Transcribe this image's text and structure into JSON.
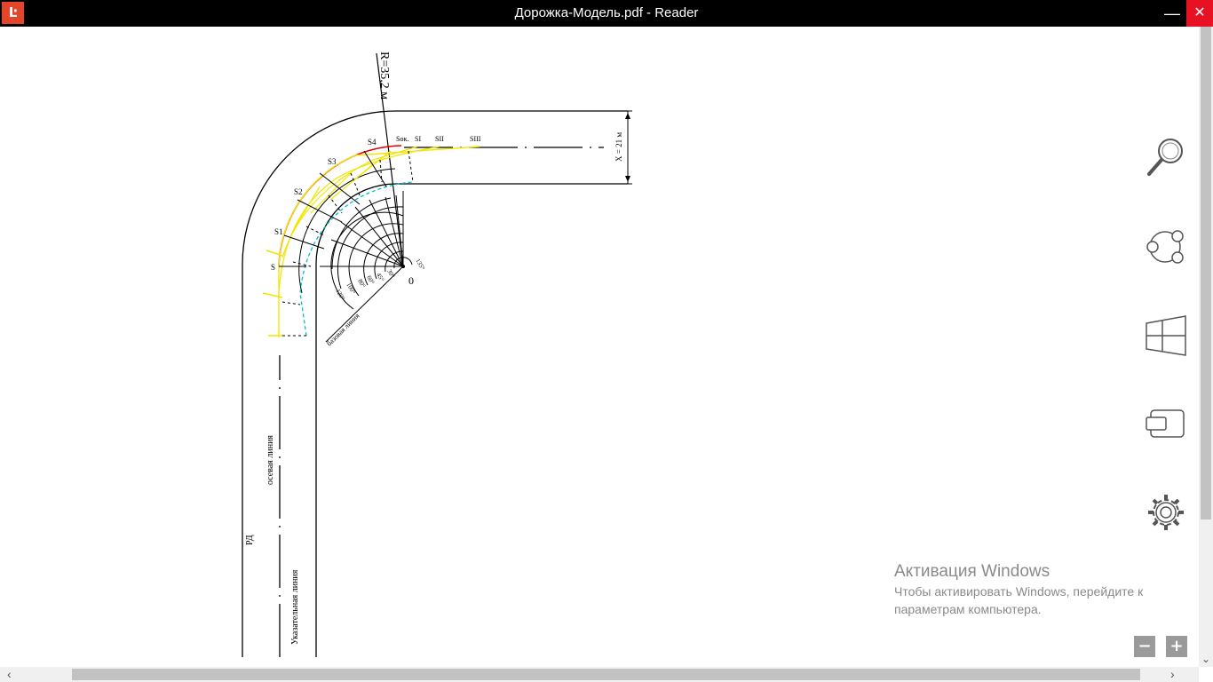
{
  "window": {
    "title": "Дорожка-Модель.pdf - Reader",
    "app_icon_glyph": "Ŀ",
    "minimize_glyph": "—",
    "close_glyph": "✕"
  },
  "drawing": {
    "radius_label": "R=35,2 м",
    "width_label": "X = 21 м",
    "label_s": "S",
    "label_s1": "S1",
    "label_s2": "S2",
    "label_s3": "S3",
    "label_s4": "S4",
    "label_sok": "Sок.",
    "label_s_i": "SI",
    "label_s_ii": "SII",
    "label_s_iii": "SIII",
    "label_center": "0",
    "angle_135": "135°",
    "angle_120": "120°",
    "angle_100": "100°",
    "angle_80": "80°",
    "angle_60": "60°",
    "angle_45": "45°",
    "angle_30": "30°",
    "base_line": "базовая линия",
    "axis_line": "осевая линия",
    "rd_label": "РД",
    "guide_line": "Указательная линия"
  },
  "charms": [
    {
      "name": "search",
      "icon": "search-icon"
    },
    {
      "name": "share",
      "icon": "share-icon"
    },
    {
      "name": "start",
      "icon": "windows-icon"
    },
    {
      "name": "devices",
      "icon": "devices-icon"
    },
    {
      "name": "settings",
      "icon": "gear-icon"
    }
  ],
  "zoom": {
    "minus": "−",
    "plus": "+"
  },
  "watermark": {
    "title": "Активация Windows",
    "line1": "Чтобы активировать Windows, перейдите к",
    "line2": "параметрам компьютера."
  },
  "scroll": {
    "left": "‹",
    "right": "›",
    "down": "⌄"
  },
  "colors": {
    "accent": "#e2452a",
    "curve_red": "#e00000",
    "curve_yellow": "#f2e600",
    "curve_cyan": "#00bcd4"
  }
}
